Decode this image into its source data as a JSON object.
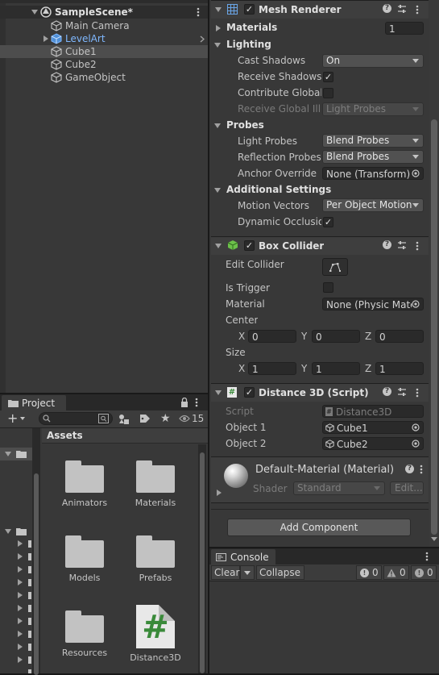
{
  "colors": {
    "panel": "#383838",
    "selection": "#4d4d4d",
    "prefab_blue": "#7fb8ff",
    "script_green": "#3a8a3a"
  },
  "hierarchy": {
    "scene_label": "SampleScene*",
    "items": [
      {
        "label": "Main Camera",
        "icon": "cube-outline-icon"
      },
      {
        "label": "LevelArt",
        "icon": "prefab-cube-icon"
      },
      {
        "label": "Cube1",
        "icon": "cube-outline-icon"
      },
      {
        "label": "Cube2",
        "icon": "cube-outline-icon"
      },
      {
        "label": "GameObject",
        "icon": "cube-outline-icon"
      }
    ]
  },
  "inspector": {
    "mesh_renderer": {
      "title": "Mesh Renderer",
      "materials_label": "Materials",
      "materials_count": "1",
      "lighting_label": "Lighting",
      "cast_shadows_label": "Cast Shadows",
      "cast_shadows_value": "On",
      "receive_shadows_label": "Receive Shadows",
      "contribute_gi_label": "Contribute Global I",
      "receive_gi_label": "Receive Global Illu",
      "receive_gi_value": "Light Probes",
      "probes_label": "Probes",
      "light_probes_label": "Light Probes",
      "light_probes_value": "Blend Probes",
      "reflection_probes_label": "Reflection Probes",
      "reflection_probes_value": "Blend Probes",
      "anchor_override_label": "Anchor Override",
      "anchor_override_value": "None (Transform)",
      "additional_settings_label": "Additional Settings",
      "motion_vectors_label": "Motion Vectors",
      "motion_vectors_value": "Per Object Motion",
      "dynamic_occlusion_label": "Dynamic Occlusio"
    },
    "box_collider": {
      "title": "Box Collider",
      "edit_collider_label": "Edit Collider",
      "is_trigger_label": "Is Trigger",
      "material_label": "Material",
      "material_value": "None (Physic Mate",
      "center_label": "Center",
      "center": {
        "x": "0",
        "y": "0",
        "z": "0"
      },
      "size_label": "Size",
      "size": {
        "x": "1",
        "y": "1",
        "z": "1"
      },
      "axis_x": "X",
      "axis_y": "Y",
      "axis_z": "Z"
    },
    "distance3d": {
      "title": "Distance 3D (Script)",
      "script_label": "Script",
      "script_value": "Distance3D",
      "object1_label": "Object 1",
      "object1_value": "Cube1",
      "object2_label": "Object 2",
      "object2_value": "Cube2"
    },
    "material": {
      "title": "Default-Material (Material)",
      "shader_label": "Shader",
      "shader_value": "Standard",
      "edit_label": "Edit..."
    },
    "add_component_label": "Add Component"
  },
  "project": {
    "tab_label": "Project",
    "visibility_count": "15",
    "breadcrumb": "Assets",
    "assets": [
      {
        "label": "Animators",
        "type": "folder"
      },
      {
        "label": "Materials",
        "type": "folder"
      },
      {
        "label": "Models",
        "type": "folder"
      },
      {
        "label": "Prefabs",
        "type": "folder"
      },
      {
        "label": "Resources",
        "type": "folder"
      },
      {
        "label": "Distance3D",
        "type": "script"
      }
    ],
    "script_glyph": "#"
  },
  "console": {
    "tab_label": "Console",
    "clear_label": "Clear",
    "collapse_label": "Collapse",
    "info_count": "0",
    "warning_count": "0",
    "error_count": "0"
  }
}
